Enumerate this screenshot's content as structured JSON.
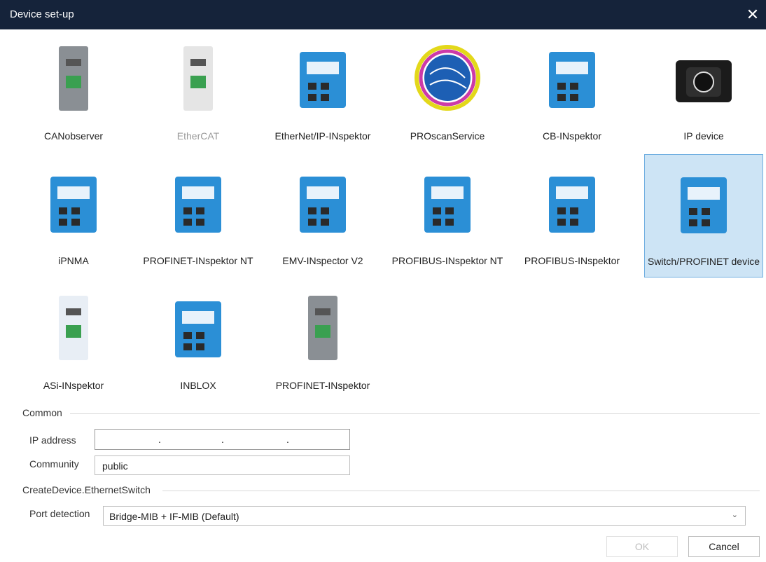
{
  "window": {
    "title": "Device set-up",
    "close_glyph": "✕"
  },
  "devices": [
    {
      "label": "CANobserver",
      "icon": "canobserver-device-icon"
    },
    {
      "label": "EtherCAT",
      "icon": "ethercat-device-icon",
      "disabled": true
    },
    {
      "label": "EtherNet/IP-INspektor",
      "icon": "ethernetip-inspektor-icon"
    },
    {
      "label": "PROscanService",
      "icon": "proscan-service-icon"
    },
    {
      "label": "CB-INspektor",
      "icon": "cb-inspektor-icon"
    },
    {
      "label": "IP device",
      "icon": "ip-device-icon"
    },
    {
      "label": "iPNMA",
      "icon": "ipnma-device-icon"
    },
    {
      "label": "PROFINET-INspektor NT",
      "icon": "profinet-inspektor-nt-icon"
    },
    {
      "label": "EMV-INspector V2",
      "icon": "emv-inspector-v2-icon"
    },
    {
      "label": "PROFIBUS-INspektor NT",
      "icon": "profibus-inspektor-nt-icon"
    },
    {
      "label": "PROFIBUS-INspektor",
      "icon": "profibus-inspektor-icon"
    },
    {
      "label": "Switch/PROFINET device",
      "icon": "switch-profinet-device-icon",
      "selected": true
    },
    {
      "label": "ASi-INspektor",
      "icon": "asi-inspektor-icon"
    },
    {
      "label": "INBLOX",
      "icon": "inblox-device-icon"
    },
    {
      "label": "PROFINET-INspektor",
      "icon": "profinet-inspektor-icon"
    }
  ],
  "common": {
    "section_label": "Common",
    "ip_label": "IP address",
    "ip_dots": ".",
    "community_label": "Community",
    "community_value": "public"
  },
  "ethernet_switch": {
    "section_label": "CreateDevice.EthernetSwitch",
    "port_detection_label": "Port detection",
    "port_detection_value": "Bridge-MIB + IF-MIB (Default)"
  },
  "buttons": {
    "ok": "OK",
    "cancel": "Cancel"
  },
  "colors": {
    "titlebar": "#15233a",
    "selected_bg": "#cde4f5",
    "selected_border": "#6faee0",
    "device_blue": "#2b8fd6"
  }
}
